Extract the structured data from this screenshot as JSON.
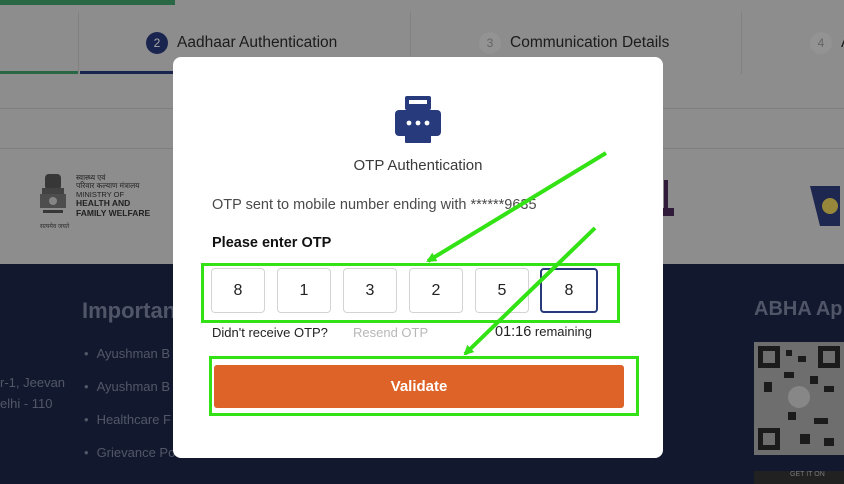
{
  "stepper": {
    "steps": [
      {
        "number": "2",
        "label": "Aadhaar Authentication",
        "active": true
      },
      {
        "number": "3",
        "label": "Communication Details",
        "active": false
      },
      {
        "number": "4",
        "label": "A",
        "active": false
      }
    ]
  },
  "header": {
    "ministry_lines": [
      "स्वास्थ्य एवं",
      "परिवार कल्याण मंत्रालय",
      "MINISTRY OF",
      "HEALTH AND",
      "FAMILY WELFARE"
    ],
    "emblem_caption": "सत्यमेव जयते"
  },
  "footer": {
    "heading": "Importan",
    "links": [
      "Ayushman B",
      "Ayushman B",
      "Healthcare F",
      "Grievance Po"
    ],
    "address_lines": [
      "r-1, Jeevan",
      "elhi - 110"
    ],
    "abha_heading": "ABHA Ap",
    "store_badge": "GET IT ON"
  },
  "modal": {
    "icon": "printer-icon",
    "title": "OTP Authentication",
    "otp_sent_text": "OTP sent to mobile number ending with ******9635",
    "enter_label": "Please enter OTP",
    "otp_digits": [
      "8",
      "1",
      "3",
      "2",
      "5",
      "8"
    ],
    "didnt_receive": "Didn't receive OTP?",
    "resend_label": "Resend OTP",
    "timer_value": "01:16",
    "timer_suffix": "remaining",
    "validate_label": "Validate"
  },
  "colors": {
    "accent_orange": "#dd6328",
    "brand_navy": "#283a7a",
    "highlight_green": "#33e214",
    "footer_bg": "#1c2747"
  }
}
